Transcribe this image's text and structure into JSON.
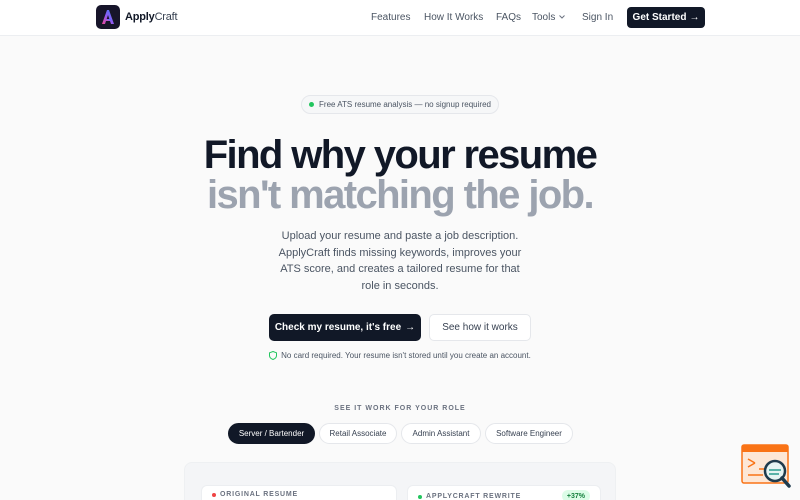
{
  "nav": {
    "brand_bold": "Apply",
    "brand_light": "Craft",
    "links": [
      "Features",
      "How It Works",
      "FAQs",
      "Tools",
      "Sign In"
    ],
    "cta": "Get Started",
    "cta_arrow": "→"
  },
  "hero": {
    "pill": "Free ATS resume analysis — no signup required",
    "title_line1": "Find why your resume",
    "title_line2": "isn't matching the job.",
    "subtitle": "Upload your resume and paste a job description. ApplyCraft finds missing keywords, improves your ATS score, and creates a tailored resume for that role in seconds.",
    "primary_button": "Check my resume, it's free",
    "primary_arrow": "→",
    "secondary_button": "See how it works",
    "note": "No card required. Your resume isn't stored until you create an account."
  },
  "roles": {
    "label": "SEE IT WORK FOR YOUR ROLE",
    "tabs": [
      "Server / Bartender",
      "Retail Associate",
      "Admin Assistant",
      "Software Engineer"
    ],
    "active_index": 0
  },
  "preview": {
    "original_label": "ORIGINAL RESUME",
    "rewrite_label": "APPLYCRAFT REWRITE",
    "score_badge": "+37%"
  },
  "icons": {
    "logo": "applycraft-logo-icon",
    "caret": "chevron-down-icon",
    "shield": "shield-check-icon",
    "widget": "document-search-icon"
  },
  "colors": {
    "dark": "#111827",
    "muted_title": "#9ca3af",
    "accent_green": "#22c55e",
    "logo_purple": "#7c3aed",
    "widget_orange": "#f97316"
  }
}
